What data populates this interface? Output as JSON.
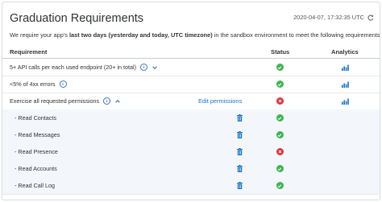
{
  "header": {
    "title": "Graduation Requirements",
    "timestamp": "2020-04-07, 17:32:35 UTC",
    "refresh_icon": "refresh-icon"
  },
  "description": {
    "prefix": "We require your app's ",
    "bold": "last two days (yesterday and today, UTC timezone)",
    "suffix": " in the sandbox environment to meet the following requirements."
  },
  "columns": {
    "requirement": "Requirement",
    "status": "Status",
    "analytics": "Analytics"
  },
  "rows": [
    {
      "label": "5+ API calls per each used endpoint (20+ in total)",
      "info": true,
      "chevron": "down",
      "status": "ok",
      "analytics": true,
      "sub": false
    },
    {
      "label": "<5% of 4xx errors",
      "info": true,
      "chevron": "",
      "status": "ok",
      "analytics": true,
      "sub": false
    },
    {
      "label": "Exercise all requested permissions",
      "info": true,
      "chevron": "up",
      "status": "error",
      "analytics": true,
      "sub": false,
      "link": "Edit permissions"
    },
    {
      "label": "- Read Contacts",
      "status": "ok",
      "trash": true,
      "sub": true
    },
    {
      "label": "- Read Messages",
      "status": "ok",
      "trash": true,
      "sub": true
    },
    {
      "label": "- Read Presence",
      "status": "error",
      "trash": true,
      "sub": true
    },
    {
      "label": "- Read Accounts",
      "status": "ok",
      "trash": true,
      "sub": true
    },
    {
      "label": "- Read Call Log",
      "status": "ok",
      "trash": true,
      "sub": true
    }
  ],
  "colors": {
    "ok": "#3fb551",
    "error": "#e0343b",
    "link": "#1a73c9",
    "info": "#3a78c3",
    "sub_row_bg": "#f3f7fb"
  }
}
